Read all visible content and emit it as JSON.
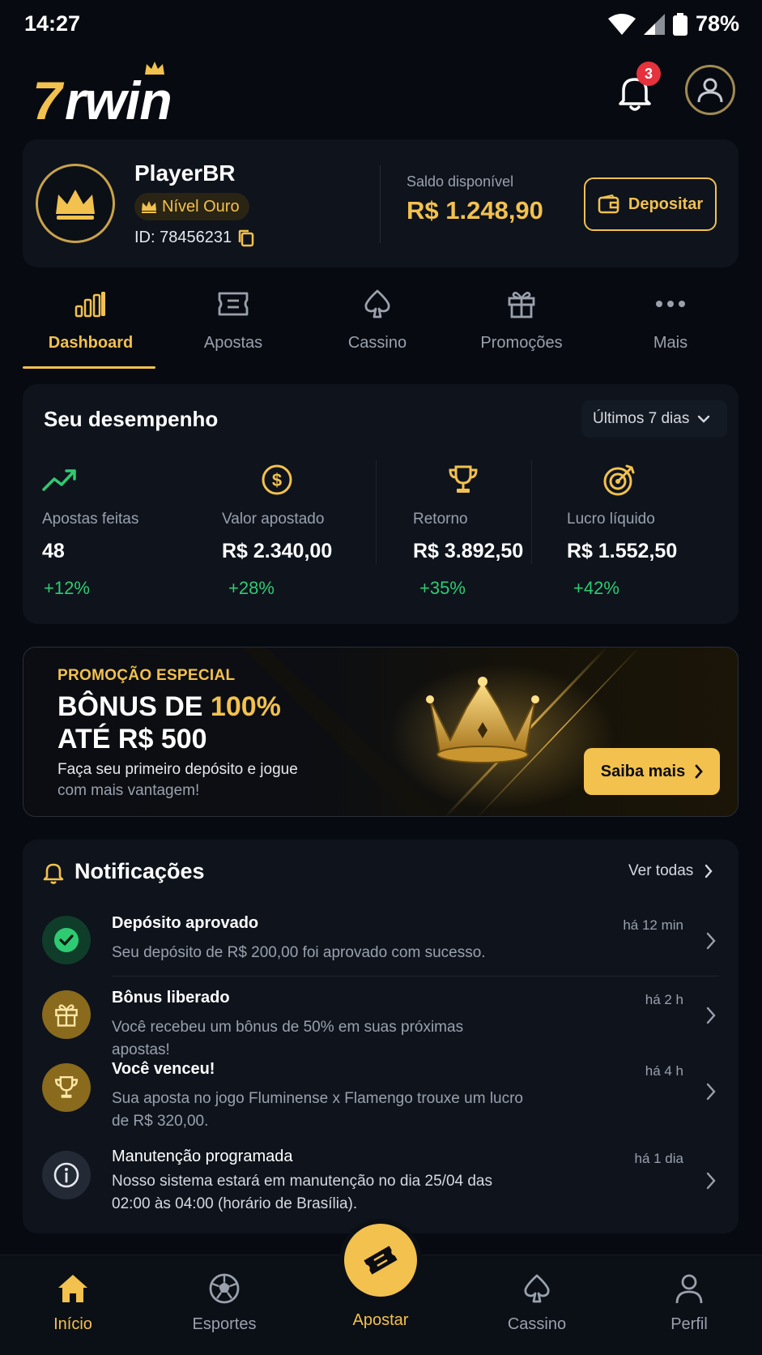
{
  "status_bar": {
    "time": "14:27",
    "battery": "78%"
  },
  "header": {
    "logo_number": "7",
    "logo_text": "rwin",
    "notification_count": "3"
  },
  "account": {
    "name": "PlayerBR",
    "level": "Nível Ouro",
    "id": "ID: 78456231",
    "balance_label": "Saldo disponível",
    "balance": "R$ 1.248,90",
    "deposit_label": "Depositar"
  },
  "tabs": [
    {
      "label": "Dashboard",
      "icon": "bar-chart-icon",
      "active": true
    },
    {
      "label": "Apostas",
      "icon": "ticket-icon"
    },
    {
      "label": "Cassino",
      "icon": "spade-icon"
    },
    {
      "label": "Promoções",
      "icon": "gift-icon"
    },
    {
      "label": "Mais",
      "icon": "more-icon"
    }
  ],
  "performance": {
    "title": "Seu desempenho",
    "period": "Últimos 7 dias",
    "stats": [
      {
        "label": "Apostas feitas",
        "value": "48",
        "delta": "+12%",
        "icon": "trend-up-icon"
      },
      {
        "label": "Valor apostado",
        "value": "R$ 2.340,00",
        "delta": "+28%",
        "icon": "dollar-coin-icon"
      },
      {
        "label": "Retorno",
        "value": "R$ 3.892,50",
        "delta": "+35%",
        "icon": "trophy-icon"
      },
      {
        "label": "Lucro líquido",
        "value": "R$ 1.552,50",
        "delta": "+42%",
        "icon": "target-icon"
      }
    ]
  },
  "promo": {
    "eyebrow": "PROMOÇÃO ESPECIAL",
    "title_prefix": "BÔNUS DE ",
    "title_highlight": "100%",
    "title_line2": "ATÉ R$ 500",
    "desc_line1": "Faça seu primeiro depósito e jogue",
    "desc_line2": "com mais vantagem!",
    "button": "Saiba mais"
  },
  "notifications": {
    "title": "Notificações",
    "see_all": "Ver todas",
    "items": [
      {
        "title": "Depósito aprovado",
        "desc": "Seu depósito de R$ 200,00 foi aprovado com sucesso.",
        "time": "há 12 min",
        "icon": "check-circle-icon"
      },
      {
        "title": "Bônus liberado",
        "desc": "Você recebeu um bônus de 50% em suas próximas apostas!",
        "time": "há 2 h",
        "icon": "gift-icon"
      },
      {
        "title": "Você venceu!",
        "desc": "Sua aposta no jogo Fluminense x Flamengo trouxe um lucro de R$ 320,00.",
        "time": "há 4 h",
        "icon": "trophy-icon"
      },
      {
        "title": "Manutenção programada",
        "desc": "Nosso sistema estará em manutenção no dia 25/04 das 02:00 às 04:00 (horário de Brasília).",
        "time": "há 1 dia",
        "icon": "info-icon"
      }
    ]
  },
  "bottom_nav": [
    {
      "label": "Início",
      "icon": "home-icon",
      "active": true
    },
    {
      "label": "Esportes",
      "icon": "soccer-ball-icon"
    },
    {
      "label": "Apostar",
      "icon": "ticket-icon"
    },
    {
      "label": "Cassino",
      "icon": "spade-icon"
    },
    {
      "label": "Perfil",
      "icon": "user-icon"
    }
  ],
  "colors": {
    "accent": "#f2c14e",
    "background": "#070a10",
    "card": "#0e131c",
    "positive": "#2ecb72",
    "badge": "#e5323d"
  }
}
